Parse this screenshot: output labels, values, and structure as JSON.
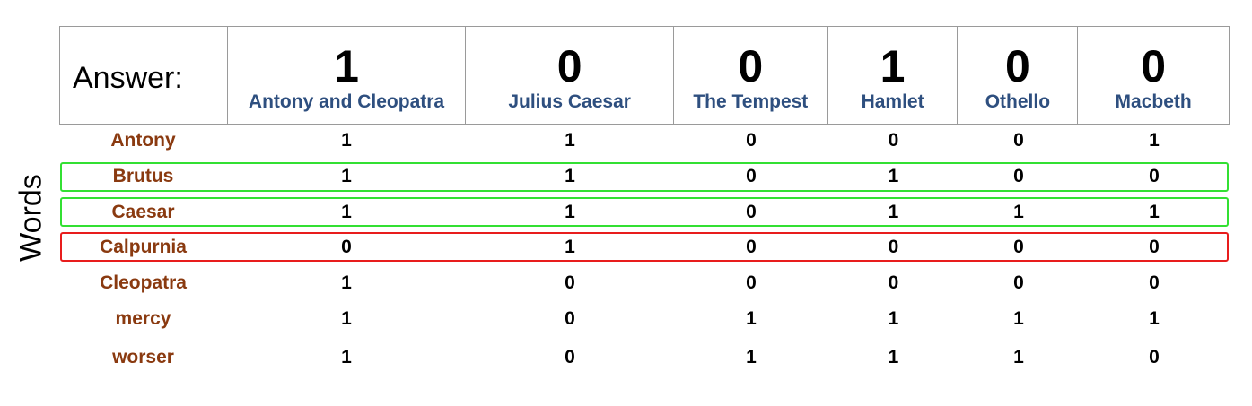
{
  "axis_label": "Words",
  "answer_label": "Answer:",
  "plays": [
    "Antony and Cleopatra",
    "Julius Caesar",
    "The Tempest",
    "Hamlet",
    "Othello",
    "Macbeth"
  ],
  "answer": [
    "1",
    "0",
    "0",
    "1",
    "0",
    "0"
  ],
  "rows": [
    {
      "word": "Antony",
      "values": [
        "1",
        "1",
        "0",
        "0",
        "0",
        "1"
      ]
    },
    {
      "word": "Brutus",
      "values": [
        "1",
        "1",
        "0",
        "1",
        "0",
        "0"
      ]
    },
    {
      "word": "Caesar",
      "values": [
        "1",
        "1",
        "0",
        "1",
        "1",
        "1"
      ]
    },
    {
      "word": "Calpurnia",
      "values": [
        "0",
        "1",
        "0",
        "0",
        "0",
        "0"
      ]
    },
    {
      "word": "Cleopatra",
      "values": [
        "1",
        "0",
        "0",
        "0",
        "0",
        "0"
      ]
    },
    {
      "word": "mercy",
      "values": [
        "1",
        "0",
        "1",
        "1",
        "1",
        "1"
      ]
    },
    {
      "word": "worser",
      "values": [
        "1",
        "0",
        "1",
        "1",
        "1",
        "0"
      ]
    }
  ],
  "highlights": [
    {
      "word": "Brutus",
      "color": "#33e033"
    },
    {
      "word": "Caesar",
      "color": "#33e033"
    },
    {
      "word": "Calpurnia",
      "color": "#e81d1d"
    }
  ]
}
